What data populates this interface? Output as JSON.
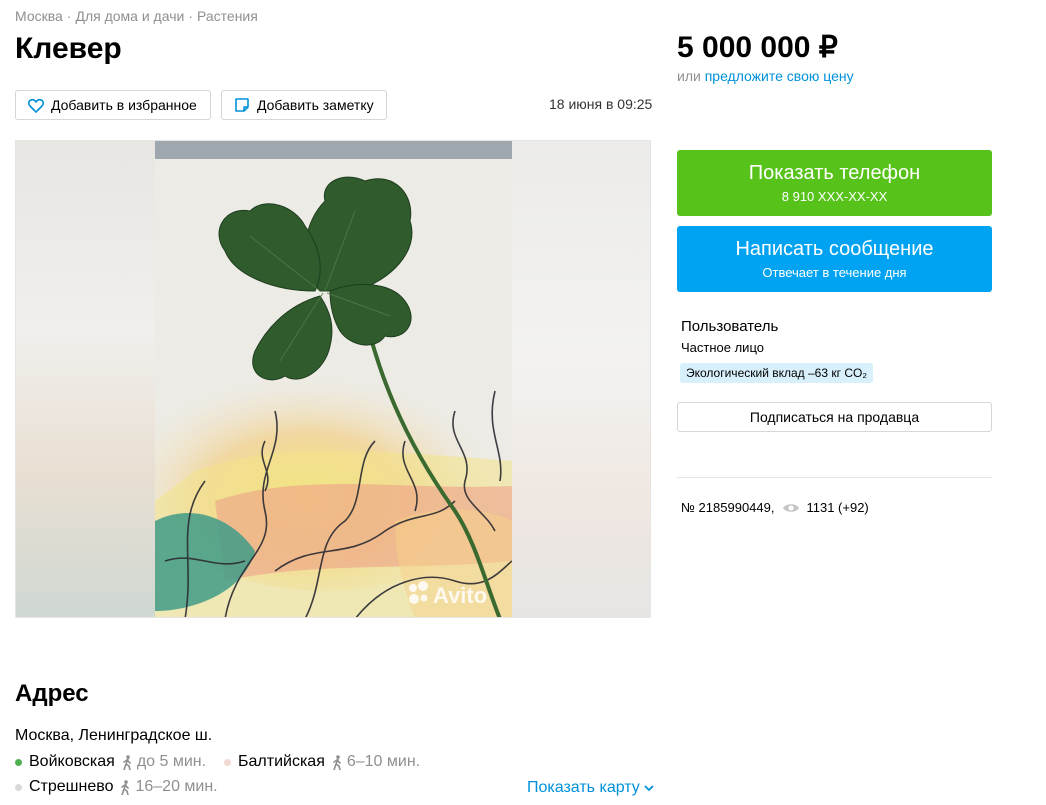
{
  "breadcrumbs": [
    "Москва",
    "Для дома и дачи",
    "Растения"
  ],
  "breadcrumb_separator": "·",
  "title": "Клевер",
  "actions": {
    "favorite_label": "Добавить в избранное",
    "note_label": "Добавить заметку"
  },
  "date": "18 июня в 09:25",
  "gallery": {
    "watermark": "Avito"
  },
  "price": "5 000 000 ₽",
  "offer": {
    "prefix": "или",
    "link": "предложите свою цену"
  },
  "contact": {
    "phone_label": "Показать телефон",
    "phone_masked": "8 910 XXX-XX-XX",
    "message_label": "Написать сообщение",
    "message_sub": "Отвечает в течение дня"
  },
  "seller": {
    "name": "Пользователь",
    "type": "Частное лицо",
    "eco_badge": "Экологический вклад –63 кг CO₂",
    "subscribe_label": "Подписаться на продавца"
  },
  "stats": {
    "ad_number": "№ 2185990449,",
    "views": "1131 (+92)"
  },
  "address": {
    "heading": "Адрес",
    "text": "Москва, Ленинградское ш.",
    "metro": [
      {
        "name": "Войковская",
        "time": "до 5 мин.",
        "color": "#4fb04f"
      },
      {
        "name": "Балтийская",
        "time": "6–10 мин.",
        "color": "#f2d9d3"
      },
      {
        "name": "Стрешнево",
        "time": "16–20 мин.",
        "color": "#d9d9d9"
      }
    ],
    "map_link": "Показать карту"
  },
  "colors": {
    "green": "#57c31a",
    "blue": "#00a3f2",
    "link": "#0091d9"
  }
}
